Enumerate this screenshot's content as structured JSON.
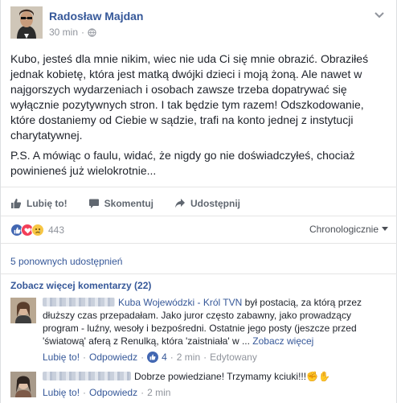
{
  "post": {
    "author": "Radosław Majdan",
    "time": "30 min",
    "paragraph1": "Kubo, jesteś dla mnie nikim, wiec nie uda Ci się mnie obrazić. Obraziłeś jednak kobietę, która jest matką dwójki dzieci i moją żoną. Ale nawet w najgorszych wydarzeniach i osobach zawsze trzeba dopatrywać się wyłącznie pozytywnych stron. I tak będzie tym razem! Odszkodowanie, które dostaniemy od Ciebie w sądzie, trafi na konto jednej z instytucji charytatywnej.",
    "paragraph2": "P.S. A mówiąc o faulu, widać, że nigdy go nie doświadczyłeś, chociaż powinieneś już wielokrotnie..."
  },
  "actions": {
    "like": "Lubię to!",
    "comment": "Skomentuj",
    "share": "Udostępnij"
  },
  "reactions": {
    "count": "443",
    "sort_label": "Chronologicznie"
  },
  "shares_text": "5 ponownych udostępnień",
  "more_comments": "Zobacz więcej komentarzy (22)",
  "comments": [
    {
      "mention": "Kuba Wojewódzki - Król TVN",
      "text": " był postacią, za którą przez dłuższy czas przepadałam. Jako juror często zabawny, jako prowadzący program - luźny, wesoły i bezpośredni. Ostatnie jego posty (jeszcze przed 'światową' aferą z Renulką, która 'zaistniała' w ...",
      "see_more": "Zobacz więcej",
      "like_label": "Lubię to!",
      "reply_label": "Odpowiedz",
      "likes": "4",
      "time": "2 min",
      "edited": "Edytowany"
    },
    {
      "text": "Dobrze powiedziane! Trzymamy kciuki!!!",
      "emoji": "✊✋",
      "like_label": "Lubię to!",
      "reply_label": "Odpowiedz",
      "time": "2 min"
    }
  ]
}
